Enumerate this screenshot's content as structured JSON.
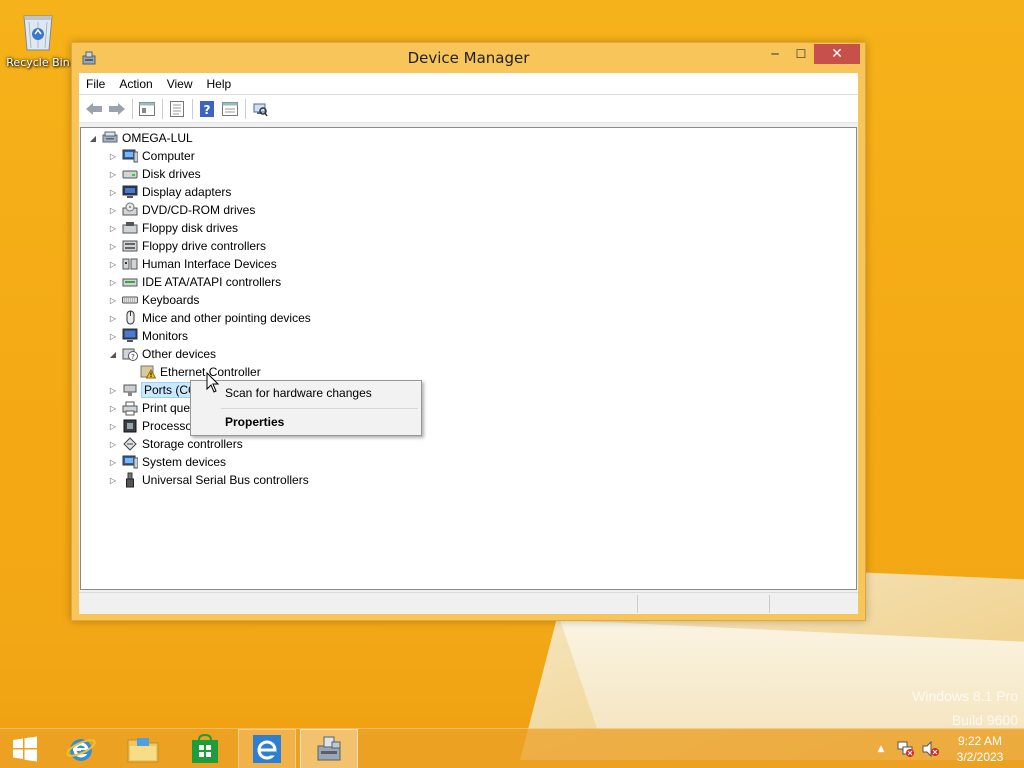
{
  "desktop": {
    "recycle_bin_label": "Recycle Bin",
    "watermark_line1": "Windows 8.1 Pro",
    "watermark_line2": "Build 9600"
  },
  "window": {
    "title": "Device Manager",
    "minimize_glyph": "─",
    "maximize_glyph": "☐",
    "close_glyph": "✕"
  },
  "menu": [
    "File",
    "Action",
    "View",
    "Help"
  ],
  "toolbar_icons": [
    "back-icon",
    "forward-icon",
    "properties-sheet-icon",
    "console-tree-icon",
    "help-icon",
    "view-icon",
    "scan-hardware-icon"
  ],
  "tree": {
    "root": "OMEGA-LUL",
    "items": [
      {
        "label": "Computer",
        "icon": "computer-icon",
        "state": "collapsed"
      },
      {
        "label": "Disk drives",
        "icon": "disk-drive-icon",
        "state": "collapsed"
      },
      {
        "label": "Display adapters",
        "icon": "display-adapter-icon",
        "state": "collapsed"
      },
      {
        "label": "DVD/CD-ROM drives",
        "icon": "dvd-drive-icon",
        "state": "collapsed"
      },
      {
        "label": "Floppy disk drives",
        "icon": "floppy-disk-icon",
        "state": "collapsed"
      },
      {
        "label": "Floppy drive controllers",
        "icon": "floppy-controller-icon",
        "state": "collapsed"
      },
      {
        "label": "Human Interface Devices",
        "icon": "hid-icon",
        "state": "collapsed"
      },
      {
        "label": "IDE ATA/ATAPI controllers",
        "icon": "ide-controller-icon",
        "state": "collapsed"
      },
      {
        "label": "Keyboards",
        "icon": "keyboard-icon",
        "state": "collapsed"
      },
      {
        "label": "Mice and other pointing devices",
        "icon": "mouse-icon",
        "state": "collapsed"
      },
      {
        "label": "Monitors",
        "icon": "monitor-icon",
        "state": "collapsed"
      },
      {
        "label": "Other devices",
        "icon": "unknown-device-icon",
        "state": "expanded"
      },
      {
        "label": "Ethernet Controller",
        "icon": "warning-device-icon",
        "state": "child"
      },
      {
        "label": "Ports (CO",
        "icon": "port-icon",
        "state": "collapsed"
      },
      {
        "label": "Print que",
        "icon": "printer-icon",
        "state": "collapsed"
      },
      {
        "label": "Processo",
        "icon": "processor-icon",
        "state": "collapsed"
      },
      {
        "label": "Storage controllers",
        "icon": "storage-controller-icon",
        "state": "collapsed"
      },
      {
        "label": "System devices",
        "icon": "system-devices-icon",
        "state": "collapsed"
      },
      {
        "label": "Universal Serial Bus controllers",
        "icon": "usb-icon",
        "state": "collapsed"
      }
    ]
  },
  "context_menu": {
    "scan": "Scan for hardware changes",
    "properties": "Properties"
  },
  "taskbar": {
    "apps": [
      "start-icon",
      "internet-explorer-icon",
      "file-explorer-icon",
      "store-icon",
      "internet-explorer-icon",
      "device-manager-icon"
    ],
    "time": "9:22 AM",
    "date": "3/2/2023"
  },
  "colors": {
    "window_frame": "#f8c55a",
    "close_button": "#c7504a",
    "selection": "#cce8ff",
    "taskbar": "#eba028"
  }
}
